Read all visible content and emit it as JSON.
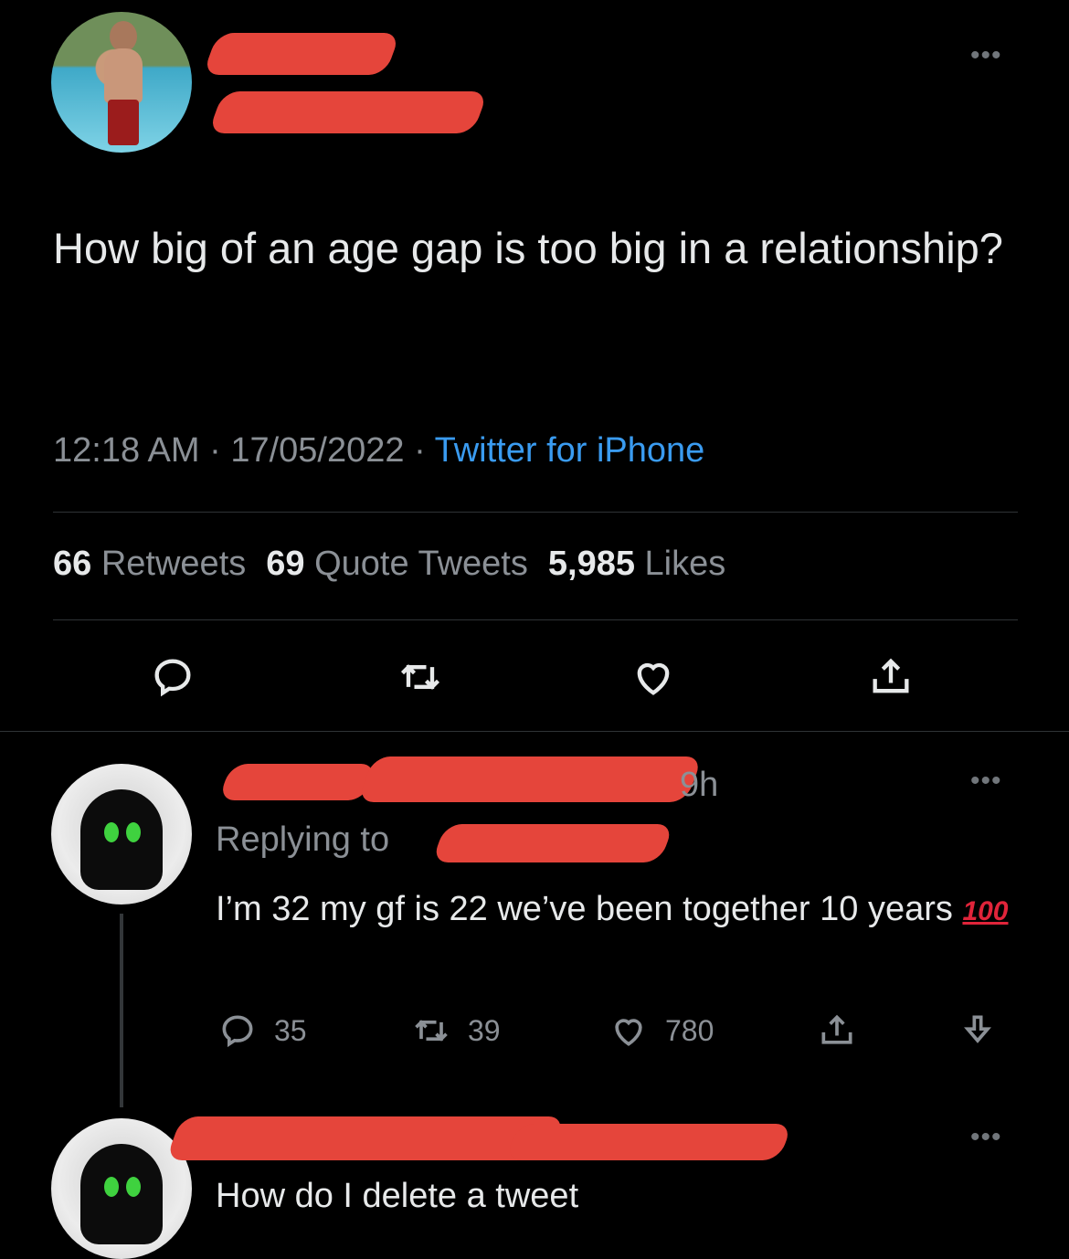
{
  "main_tweet": {
    "text": "How big of an age gap is too big in a relationship?",
    "time": "12:18 AM",
    "sep1": " · ",
    "date": "17/05/2022",
    "sep2": " · ",
    "source": "Twitter for iPhone",
    "retweets_count": "66",
    "retweets_label": "Retweets",
    "quotes_count": "69",
    "quotes_label": "Quote Tweets",
    "likes_count": "5,985",
    "likes_label": "Likes",
    "more": "•••"
  },
  "reply1": {
    "time": "9h",
    "replying_prefix": "Replying to",
    "text": "I’m 32 my gf is 22 we’ve been together 10 years",
    "emoji": "100",
    "replies": "35",
    "retweets": "39",
    "likes": "780",
    "more": "•••"
  },
  "reply2": {
    "text": "How do I delete a tweet",
    "more": "•••"
  },
  "colors": {
    "background": "#000000",
    "link": "#3a9bf0",
    "muted": "#8b9096",
    "redaction": "#e5453b"
  }
}
